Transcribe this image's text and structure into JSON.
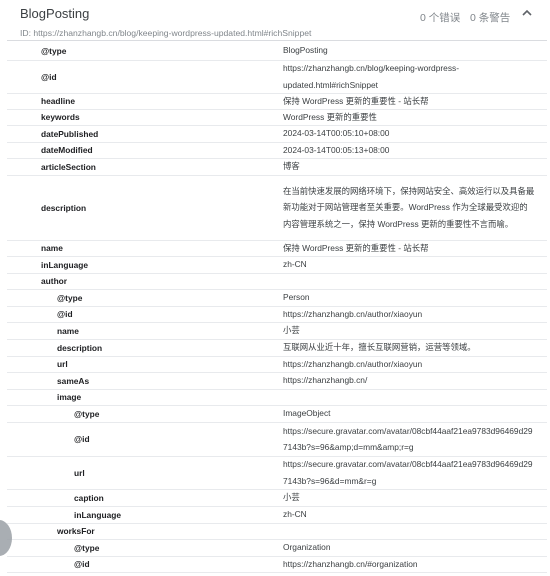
{
  "card": {
    "title": "BlogPosting",
    "errors": "0 个错误",
    "warnings": "0 条警告",
    "id_line": "ID: https://zhanzhangb.cn/blog/keeping-wordpress-updated.html#richSnippet"
  },
  "rows": [
    {
      "key": "@type",
      "value": "BlogPosting"
    },
    {
      "key": "@id",
      "value": "https://zhanzhangb.cn/blog/keeping-wordpress-updated.html#richSnippet"
    },
    {
      "key": "headline",
      "value": "保持 WordPress 更新的重要性 - 站长帮"
    },
    {
      "key": "keywords",
      "value": "WordPress 更新的重要性"
    },
    {
      "key": "datePublished",
      "value": "2024-03-14T00:05:10+08:00"
    },
    {
      "key": "dateModified",
      "value": "2024-03-14T00:05:13+08:00"
    },
    {
      "key": "articleSection",
      "value": "博客"
    },
    {
      "key": "description",
      "value": "在当前快速发展的网络环境下，保持网站安全、高效运行以及具备最新功能对于网站管理者至关重要。WordPress 作为全球最受欢迎的内容管理系统之一，保持 WordPress 更新的重要性不言而喻。"
    },
    {
      "key": "name",
      "value": "保持 WordPress 更新的重要性 - 站长帮"
    },
    {
      "key": "inLanguage",
      "value": "zh-CN"
    },
    {
      "key": "author",
      "value": ""
    },
    {
      "key": "@type",
      "value": "Person"
    },
    {
      "key": "@id",
      "value": "https://zhanzhangb.cn/author/xiaoyun"
    },
    {
      "key": "name",
      "value": "小芸"
    },
    {
      "key": "description",
      "value": "互联网从业近十年，擅长互联网营销，运营等领域。"
    },
    {
      "key": "url",
      "value": "https://zhanzhangb.cn/author/xiaoyun"
    },
    {
      "key": "sameAs",
      "value": "https://zhanzhangb.cn/"
    },
    {
      "key": "image",
      "value": ""
    },
    {
      "key": "@type",
      "value": "ImageObject"
    },
    {
      "key": "@id",
      "value": "https://secure.gravatar.com/avatar/08cbf44aaf21ea9783d96469d297143b?s=96&amp;d=mm&amp;r=g"
    },
    {
      "key": "url",
      "value": "https://secure.gravatar.com/avatar/08cbf44aaf21ea9783d96469d297143b?s=96&d=mm&r=g"
    },
    {
      "key": "caption",
      "value": "小芸"
    },
    {
      "key": "inLanguage",
      "value": "zh-CN"
    },
    {
      "key": "worksFor",
      "value": ""
    },
    {
      "key": "@type",
      "value": "Organization"
    },
    {
      "key": "@id",
      "value": "https://zhanzhangb.cn/#organization"
    }
  ]
}
